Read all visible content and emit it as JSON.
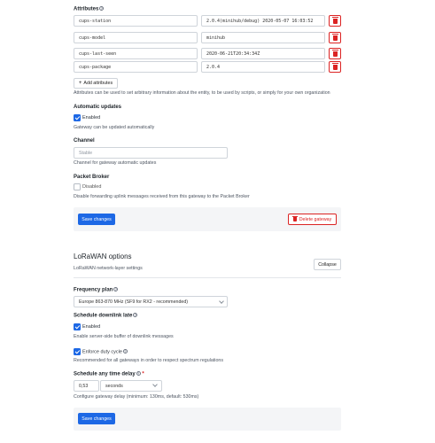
{
  "attributes": {
    "label": "Attributes",
    "rows": [
      {
        "key": "cups-station",
        "value": "2.0.4(minihub/debug) 2020-05-07 16:03:52"
      },
      {
        "key": "cups-model",
        "value": "minihub"
      },
      {
        "key": "cups-last-seen",
        "value": "2020-06-21T20:34:34Z"
      },
      {
        "key": "cups-package",
        "value": "2.0.4"
      }
    ],
    "add_label": "Add attributes",
    "description": "Attributes can be used to set arbitrary information about the entity, to be used by scripts, or simply for your own organization"
  },
  "automatic_updates": {
    "label": "Automatic updates",
    "checkbox_label": "Enabled",
    "checked": true,
    "description": "Gateway can be updated automatically"
  },
  "channel": {
    "label": "Channel",
    "placeholder": "Stable",
    "description": "Channel for gateway automatic updates"
  },
  "packet_broker": {
    "label": "Packet Broker",
    "checkbox_label": "Disabled",
    "checked": false,
    "description": "Disable forwarding uplink messages received from this gateway to the Packet Broker"
  },
  "general_footer": {
    "save_label": "Save changes",
    "delete_label": "Delete gateway"
  },
  "lorawan": {
    "title": "LoRaWAN options",
    "subtitle": "LoRaWAN network-layer settings",
    "collapse_label": "Collapse",
    "frequency_plan": {
      "label": "Frequency plan",
      "value": "Europe 863-870 MHz (SF9 for RX2 - recommended)"
    },
    "schedule_downlink_late": {
      "label": "Schedule downlink late",
      "checkbox_label": "Enabled",
      "checked": true,
      "description": "Enable server-side buffer of downlink messages"
    },
    "enforce_duty_cycle": {
      "checkbox_label": "Enforce duty cycle",
      "checked": true,
      "description": "Recommended for all gateways in order to respect spectrum regulations"
    },
    "schedule_any_time_delay": {
      "label": "Schedule any time delay",
      "required_mark": "*",
      "value": "0,53",
      "unit": "seconds",
      "description": "Configure gateway delay (minimum: 130ms, default: 530ms)"
    },
    "save_label": "Save changes"
  },
  "colors": {
    "primary": "#1d68e5",
    "danger": "#db2323",
    "footer_bg": "#f4f5f7"
  }
}
